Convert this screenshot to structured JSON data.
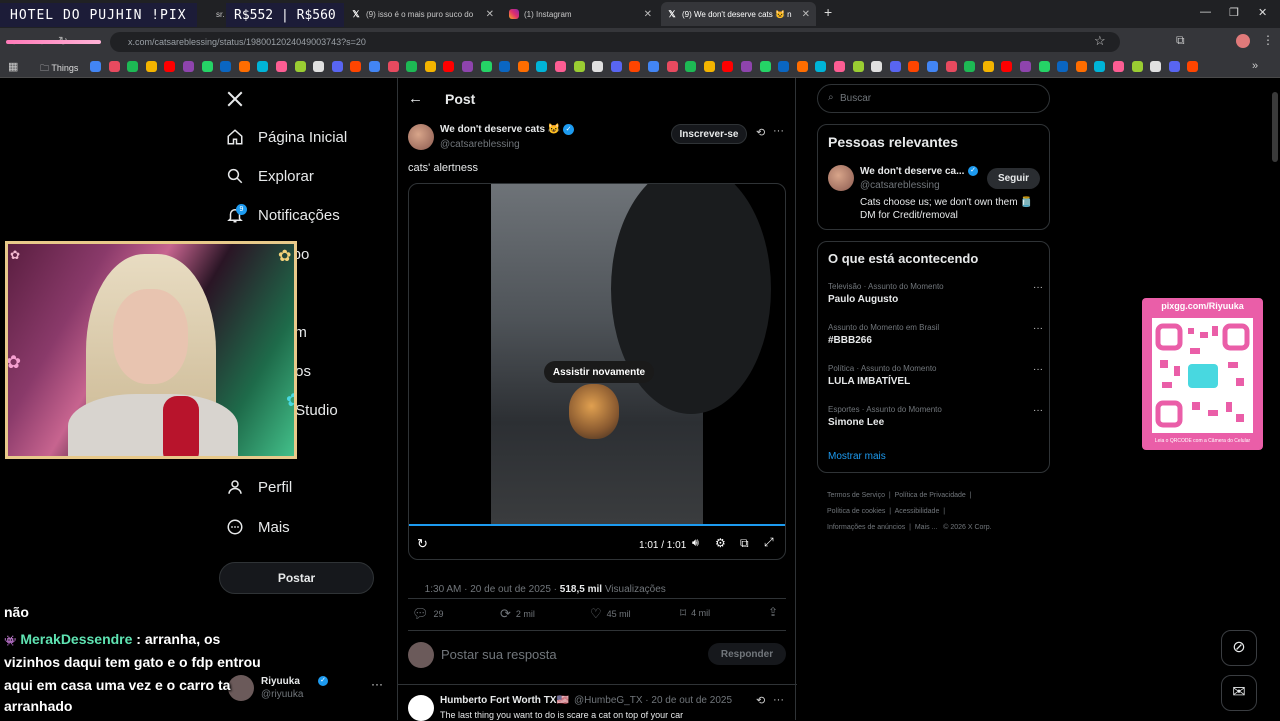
{
  "browser": {
    "overlay_title": "HOTEL DO PUJHIN !PIX",
    "overlay_money": "R$552 | R$560",
    "tabs": [
      {
        "label": "sr. d"
      },
      {
        "label": "(9) isso é o mais puro suco do"
      },
      {
        "label": "(1) Instagram"
      },
      {
        "label": "(9) We don't deserve cats 😺 n"
      }
    ],
    "url": "x.com/catsareblessing/status/1980012024049003743?s=20",
    "bookmark_folder": "Things"
  },
  "sidebar": {
    "items": [
      {
        "label": "Página Inicial",
        "icon": "home-icon"
      },
      {
        "label": "Explorar",
        "icon": "search-icon"
      },
      {
        "label": "Notificações",
        "icon": "bell-icon",
        "badge": "9"
      },
      {
        "label": "papo",
        "icon": "chat-icon"
      },
      {
        "label": "um",
        "icon": "community-icon"
      },
      {
        "label": "alvos",
        "icon": "bookmark-icon"
      },
      {
        "label": "r Studio",
        "icon": "studio-icon"
      },
      {
        "label": "s",
        "icon": "lists-icon"
      },
      {
        "label": "Perfil",
        "icon": "person-icon"
      },
      {
        "label": "Mais",
        "icon": "more-icon"
      }
    ],
    "post_button": "Postar",
    "account": {
      "name": "Riyuuka",
      "handle": "@riyuuka"
    }
  },
  "post": {
    "header": "Post",
    "author_name": "We don't deserve cats 😺",
    "author_handle": "@catsareblessing",
    "subscribe": "Inscrever-se",
    "text": "cats' alertness",
    "replay": "Assistir novamente",
    "video_time": "1:01 / 1:01",
    "timestamp": "1:30 AM · 20 de out de 2025 · ",
    "views_count": "518,5 mil",
    "views_label": "Visualizações",
    "stats": {
      "replies": "29",
      "reposts": "2 mil",
      "likes": "45 mil",
      "bookmarks": "4 mil"
    },
    "reply_placeholder": "Postar sua resposta",
    "reply_button": "Responder",
    "reply_preview": {
      "name": "Humberto Fort Worth TX🇺🇸",
      "handle": "@HumbeG_TX · 20 de out de 2025",
      "text": "The last thing you want to do is scare a cat on top of your car"
    }
  },
  "right": {
    "search_placeholder": "Buscar",
    "relevant": {
      "title": "Pessoas relevantes",
      "name": "We don't deserve ca...",
      "handle": "@catsareblessing",
      "follow": "Seguir",
      "bio": "Cats choose us; we don't own them 🫙 DM for Credit/removal"
    },
    "trends_title": "O que está acontecendo",
    "trends": [
      {
        "meta": "Televisão · Assunto do Momento",
        "name": "Paulo Augusto"
      },
      {
        "meta": "Assunto do Momento em Brasil",
        "name": "#BBB266"
      },
      {
        "meta": "Política · Assunto do Momento",
        "name": "LULA IMBATÍVEL"
      },
      {
        "meta": "Esportes · Assunto do Momento",
        "name": "Simone Lee"
      }
    ],
    "show_more": "Mostrar mais",
    "footer": {
      "l1a": "Termos de Serviço",
      "l1b": "Política de Privacidade",
      "l2a": "Política de cookies",
      "l2b": "Acessibilidade",
      "l3a": "Informações de anúncios",
      "l3b": "Mais ...",
      "copy": "© 2026 X Corp."
    }
  },
  "stream": {
    "chat_lines": [
      "não",
      "MerakDessendre",
      ": arranha, os",
      "vizinhos daqui tem gato e o fdp entrou",
      "aqui em casa uma vez e o carro ta",
      "arranhado"
    ],
    "qr_title": "pixgg.com/Riyuuka",
    "qr_caption": "Leia o QRCODE com a Câmera do Celular"
  }
}
